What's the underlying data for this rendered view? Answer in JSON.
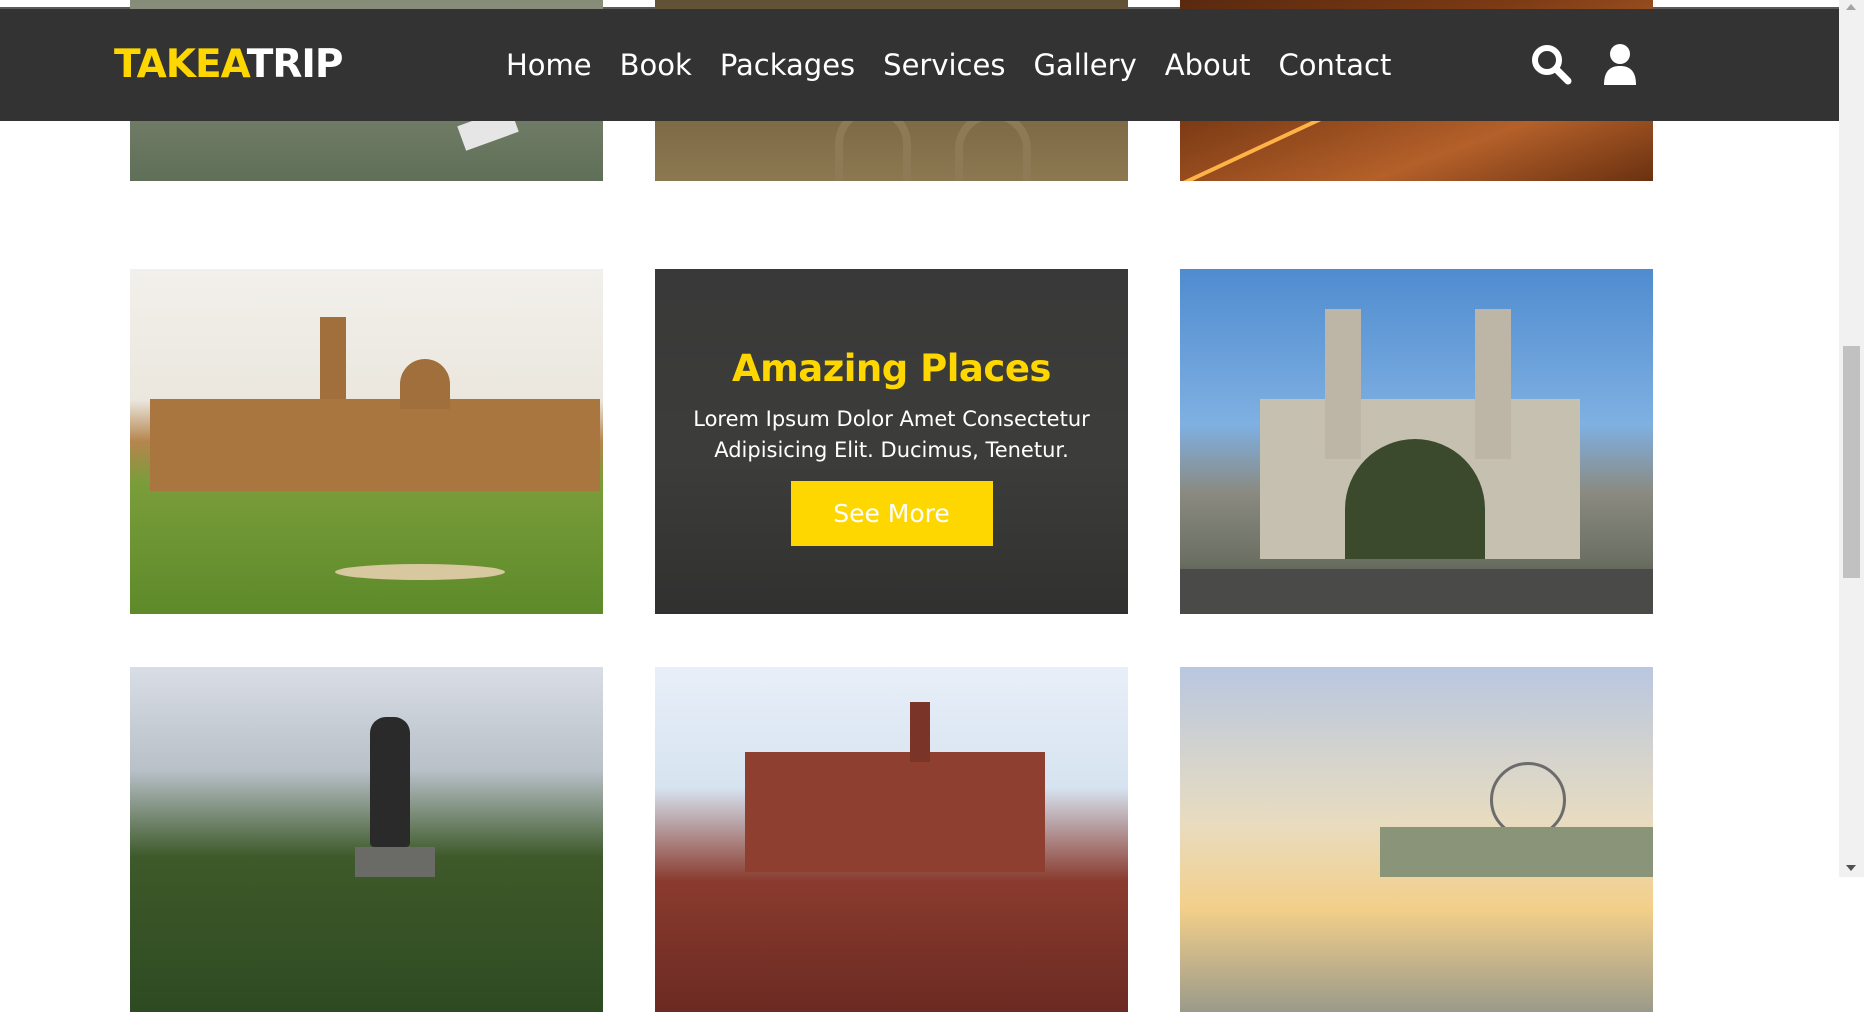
{
  "header": {
    "logo_part1": "TAKEA",
    "logo_part2": "TRIP",
    "nav": [
      "Home",
      "Book",
      "Packages",
      "Services",
      "Gallery",
      "About",
      "Contact"
    ],
    "icons": [
      "search-icon",
      "user-icon"
    ]
  },
  "gallery": {
    "overlay": {
      "title": "Amazing Places",
      "text": "Lorem Ipsum Dolor Amet Consectetur Adipisicing Elit. Ducimus, Tenetur.",
      "button": "See More"
    }
  },
  "colors": {
    "accent": "#ffd700",
    "header_bg": "#333333",
    "text_light": "#ffffff"
  }
}
